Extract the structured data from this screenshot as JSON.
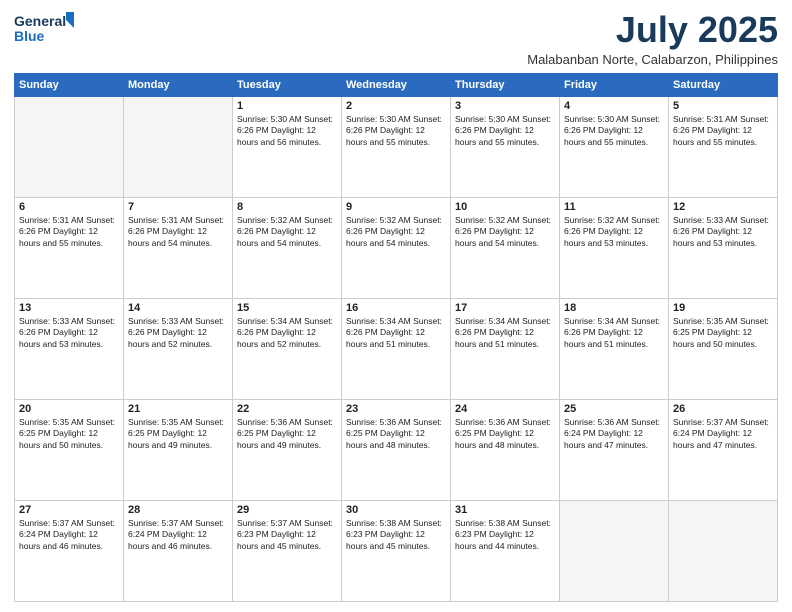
{
  "header": {
    "logo_line1": "General",
    "logo_line2": "Blue",
    "title": "July 2025",
    "subtitle": "Malabanban Norte, Calabarzon, Philippines"
  },
  "weekdays": [
    "Sunday",
    "Monday",
    "Tuesday",
    "Wednesday",
    "Thursday",
    "Friday",
    "Saturday"
  ],
  "weeks": [
    [
      {
        "day": "",
        "detail": ""
      },
      {
        "day": "",
        "detail": ""
      },
      {
        "day": "1",
        "detail": "Sunrise: 5:30 AM\nSunset: 6:26 PM\nDaylight: 12 hours\nand 56 minutes."
      },
      {
        "day": "2",
        "detail": "Sunrise: 5:30 AM\nSunset: 6:26 PM\nDaylight: 12 hours\nand 55 minutes."
      },
      {
        "day": "3",
        "detail": "Sunrise: 5:30 AM\nSunset: 6:26 PM\nDaylight: 12 hours\nand 55 minutes."
      },
      {
        "day": "4",
        "detail": "Sunrise: 5:30 AM\nSunset: 6:26 PM\nDaylight: 12 hours\nand 55 minutes."
      },
      {
        "day": "5",
        "detail": "Sunrise: 5:31 AM\nSunset: 6:26 PM\nDaylight: 12 hours\nand 55 minutes."
      }
    ],
    [
      {
        "day": "6",
        "detail": "Sunrise: 5:31 AM\nSunset: 6:26 PM\nDaylight: 12 hours\nand 55 minutes."
      },
      {
        "day": "7",
        "detail": "Sunrise: 5:31 AM\nSunset: 6:26 PM\nDaylight: 12 hours\nand 54 minutes."
      },
      {
        "day": "8",
        "detail": "Sunrise: 5:32 AM\nSunset: 6:26 PM\nDaylight: 12 hours\nand 54 minutes."
      },
      {
        "day": "9",
        "detail": "Sunrise: 5:32 AM\nSunset: 6:26 PM\nDaylight: 12 hours\nand 54 minutes."
      },
      {
        "day": "10",
        "detail": "Sunrise: 5:32 AM\nSunset: 6:26 PM\nDaylight: 12 hours\nand 54 minutes."
      },
      {
        "day": "11",
        "detail": "Sunrise: 5:32 AM\nSunset: 6:26 PM\nDaylight: 12 hours\nand 53 minutes."
      },
      {
        "day": "12",
        "detail": "Sunrise: 5:33 AM\nSunset: 6:26 PM\nDaylight: 12 hours\nand 53 minutes."
      }
    ],
    [
      {
        "day": "13",
        "detail": "Sunrise: 5:33 AM\nSunset: 6:26 PM\nDaylight: 12 hours\nand 53 minutes."
      },
      {
        "day": "14",
        "detail": "Sunrise: 5:33 AM\nSunset: 6:26 PM\nDaylight: 12 hours\nand 52 minutes."
      },
      {
        "day": "15",
        "detail": "Sunrise: 5:34 AM\nSunset: 6:26 PM\nDaylight: 12 hours\nand 52 minutes."
      },
      {
        "day": "16",
        "detail": "Sunrise: 5:34 AM\nSunset: 6:26 PM\nDaylight: 12 hours\nand 51 minutes."
      },
      {
        "day": "17",
        "detail": "Sunrise: 5:34 AM\nSunset: 6:26 PM\nDaylight: 12 hours\nand 51 minutes."
      },
      {
        "day": "18",
        "detail": "Sunrise: 5:34 AM\nSunset: 6:26 PM\nDaylight: 12 hours\nand 51 minutes."
      },
      {
        "day": "19",
        "detail": "Sunrise: 5:35 AM\nSunset: 6:25 PM\nDaylight: 12 hours\nand 50 minutes."
      }
    ],
    [
      {
        "day": "20",
        "detail": "Sunrise: 5:35 AM\nSunset: 6:25 PM\nDaylight: 12 hours\nand 50 minutes."
      },
      {
        "day": "21",
        "detail": "Sunrise: 5:35 AM\nSunset: 6:25 PM\nDaylight: 12 hours\nand 49 minutes."
      },
      {
        "day": "22",
        "detail": "Sunrise: 5:36 AM\nSunset: 6:25 PM\nDaylight: 12 hours\nand 49 minutes."
      },
      {
        "day": "23",
        "detail": "Sunrise: 5:36 AM\nSunset: 6:25 PM\nDaylight: 12 hours\nand 48 minutes."
      },
      {
        "day": "24",
        "detail": "Sunrise: 5:36 AM\nSunset: 6:25 PM\nDaylight: 12 hours\nand 48 minutes."
      },
      {
        "day": "25",
        "detail": "Sunrise: 5:36 AM\nSunset: 6:24 PM\nDaylight: 12 hours\nand 47 minutes."
      },
      {
        "day": "26",
        "detail": "Sunrise: 5:37 AM\nSunset: 6:24 PM\nDaylight: 12 hours\nand 47 minutes."
      }
    ],
    [
      {
        "day": "27",
        "detail": "Sunrise: 5:37 AM\nSunset: 6:24 PM\nDaylight: 12 hours\nand 46 minutes."
      },
      {
        "day": "28",
        "detail": "Sunrise: 5:37 AM\nSunset: 6:24 PM\nDaylight: 12 hours\nand 46 minutes."
      },
      {
        "day": "29",
        "detail": "Sunrise: 5:37 AM\nSunset: 6:23 PM\nDaylight: 12 hours\nand 45 minutes."
      },
      {
        "day": "30",
        "detail": "Sunrise: 5:38 AM\nSunset: 6:23 PM\nDaylight: 12 hours\nand 45 minutes."
      },
      {
        "day": "31",
        "detail": "Sunrise: 5:38 AM\nSunset: 6:23 PM\nDaylight: 12 hours\nand 44 minutes."
      },
      {
        "day": "",
        "detail": ""
      },
      {
        "day": "",
        "detail": ""
      }
    ]
  ]
}
